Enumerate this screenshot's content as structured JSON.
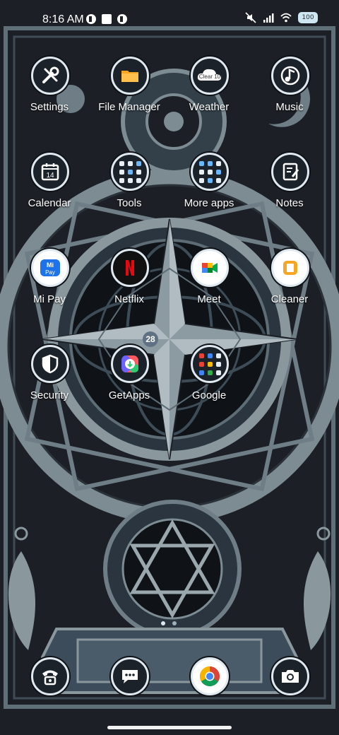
{
  "status_bar": {
    "time": "8:16 AM",
    "battery": "100"
  },
  "apps": [
    {
      "label": "Settings"
    },
    {
      "label": "File Manager"
    },
    {
      "label": "Weather",
      "icon_text": "Clear 10"
    },
    {
      "label": "Music"
    },
    {
      "label": "Calendar",
      "icon_text": "14"
    },
    {
      "label": "Tools"
    },
    {
      "label": "More apps"
    },
    {
      "label": "Notes"
    },
    {
      "label": "Mi Pay",
      "icon_text": "Mi Pay"
    },
    {
      "label": "Netflix"
    },
    {
      "label": "Meet"
    },
    {
      "label": "Cleaner"
    },
    {
      "label": "Security"
    },
    {
      "label": "GetApps"
    },
    {
      "label": "Google"
    }
  ],
  "badge": {
    "count": "28"
  },
  "dock": [
    {
      "name": "phone"
    },
    {
      "name": "messages"
    },
    {
      "name": "chrome"
    },
    {
      "name": "camera"
    }
  ],
  "colors": {
    "wallpaper_bg": "#1c2026",
    "wallpaper_line": "#7d8c93",
    "icon_ring": "#dfe9ef",
    "accent_slate": "#3c4c5a"
  }
}
